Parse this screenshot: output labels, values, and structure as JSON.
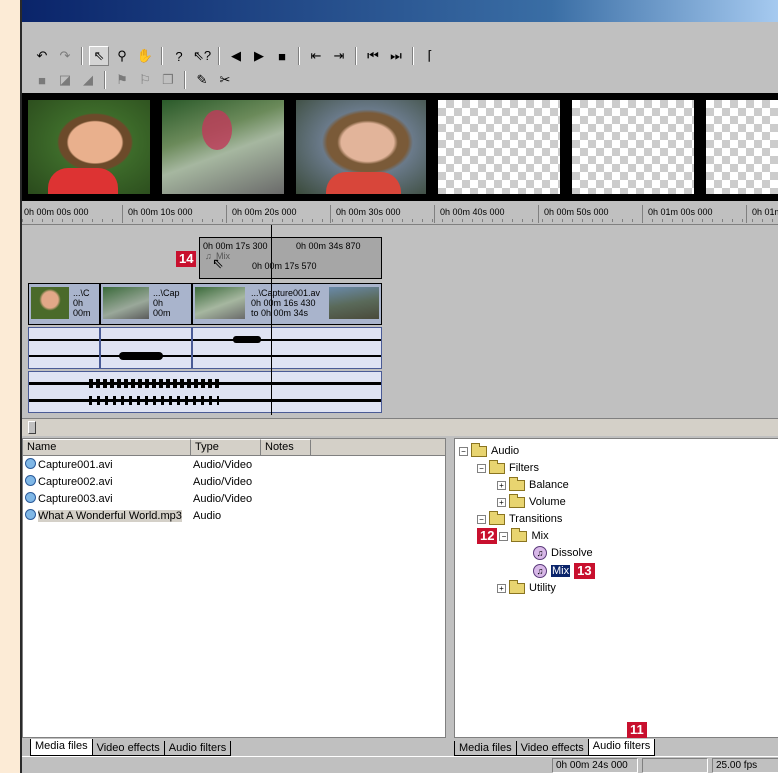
{
  "toolbar": {
    "row1_icons": [
      "undo-icon",
      "redo-icon",
      "pointer-icon",
      "zoom-icon",
      "hand-icon",
      "help-icon",
      "context-help-icon",
      "previous-icon",
      "play-icon",
      "stop-icon",
      "mark-in-icon",
      "mark-out-icon",
      "go-to-in-icon",
      "go-to-out-icon",
      "properties-icon"
    ],
    "row2_icons": [
      "snap-icon",
      "split-icon",
      "trim-icon",
      "marker-icon",
      "bookmark-icon",
      "copy-icon",
      "paste-icon",
      "delete-icon"
    ]
  },
  "ruler": {
    "labels": [
      "0h 00m 00s 000",
      "0h 00m 10s 000",
      "0h 00m 20s 000",
      "0h 00m 30s 000",
      "0h 00m 40s 000",
      "0h 00m 50s 000",
      "0h 01m 00s 000",
      "0h 01m"
    ]
  },
  "timeline": {
    "transition_clip": {
      "start": "0h 00m 17s 300",
      "end": "0h 00m 34s 870",
      "name": "Mix",
      "duration": "0h 00m 17s 570",
      "callout": "14"
    },
    "video_clips": [
      {
        "label1": "...\\C",
        "label2": "0h",
        "label3": "00m"
      },
      {
        "label1": "...\\Cap",
        "label2": "0h",
        "label3": "00m"
      },
      {
        "label1": "...\\Capture001.av",
        "label2": "0h 00m 16s 430",
        "label3": "to 0h 00m 34s"
      }
    ]
  },
  "media_files": {
    "columns": [
      "Name",
      "Type",
      "Notes"
    ],
    "rows": [
      {
        "name": "Capture001.avi",
        "type": "Audio/Video",
        "notes": ""
      },
      {
        "name": "Capture002.avi",
        "type": "Audio/Video",
        "notes": ""
      },
      {
        "name": "Capture003.avi",
        "type": "Audio/Video",
        "notes": ""
      },
      {
        "name": "What A Wonderful World.mp3",
        "type": "Audio",
        "notes": ""
      }
    ]
  },
  "tree": {
    "audio": "Audio",
    "filters": "Filters",
    "balance": "Balance",
    "volume": "Volume",
    "transitions": "Transitions",
    "mix_folder": "Mix",
    "dissolve": "Dissolve",
    "mix_item": "Mix",
    "utility": "Utility",
    "callout_12": "12",
    "callout_13": "13"
  },
  "tabs_left": [
    "Media files",
    "Video effects",
    "Audio filters"
  ],
  "tabs_right": [
    "Media files",
    "Video effects",
    "Audio filters"
  ],
  "callout_11": "11",
  "status": {
    "time": "0h 00m 24s 000",
    "fps": "25.00 fps"
  },
  "colors": {
    "callout": "#c8102e",
    "titlebar": "#0a246a"
  }
}
